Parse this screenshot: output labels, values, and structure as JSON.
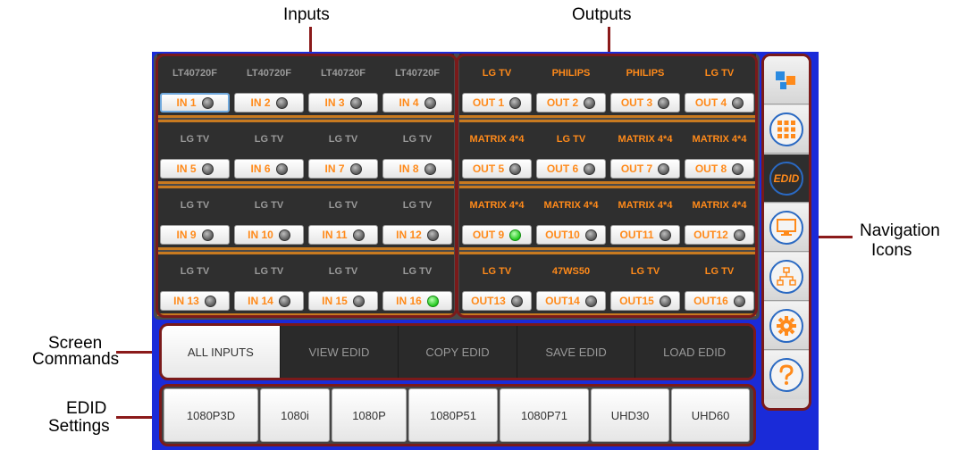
{
  "annotations": {
    "inputs": "Inputs",
    "outputs": "Outputs",
    "navigation_line1": "Navigation",
    "navigation_line2": "Icons",
    "screen_commands_line1": "Screen",
    "screen_commands_line2": "Commands",
    "edid_settings_line1": "EDID",
    "edid_settings_line2": "Settings"
  },
  "inputs": [
    {
      "label": "LT40720F",
      "button": "IN 1",
      "led": "off",
      "selected": true
    },
    {
      "label": "LT40720F",
      "button": "IN 2",
      "led": "off"
    },
    {
      "label": "LT40720F",
      "button": "IN 3",
      "led": "off"
    },
    {
      "label": "LT40720F",
      "button": "IN 4",
      "led": "off"
    },
    {
      "label": "LG TV",
      "button": "IN 5",
      "led": "off"
    },
    {
      "label": "LG TV",
      "button": "IN 6",
      "led": "off"
    },
    {
      "label": "LG TV",
      "button": "IN 7",
      "led": "off"
    },
    {
      "label": "LG TV",
      "button": "IN 8",
      "led": "off"
    },
    {
      "label": "LG TV",
      "button": "IN 9",
      "led": "off"
    },
    {
      "label": "LG TV",
      "button": "IN 10",
      "led": "off"
    },
    {
      "label": "LG TV",
      "button": "IN 11",
      "led": "off"
    },
    {
      "label": "LG TV",
      "button": "IN 12",
      "led": "off"
    },
    {
      "label": "LG TV",
      "button": "IN 13",
      "led": "off"
    },
    {
      "label": "LG TV",
      "button": "IN 14",
      "led": "off"
    },
    {
      "label": "LG TV",
      "button": "IN 15",
      "led": "off"
    },
    {
      "label": "LG TV",
      "button": "IN 16",
      "led": "on"
    }
  ],
  "outputs": [
    {
      "label": "LG TV",
      "button": "OUT 1",
      "led": "off"
    },
    {
      "label": "PHILIPS",
      "button": "OUT 2",
      "led": "off"
    },
    {
      "label": "PHILIPS",
      "button": "OUT 3",
      "led": "off"
    },
    {
      "label": "LG TV",
      "button": "OUT 4",
      "led": "off"
    },
    {
      "label": "MATRIX 4*4",
      "button": "OUT 5",
      "led": "off"
    },
    {
      "label": "LG TV",
      "button": "OUT 6",
      "led": "off"
    },
    {
      "label": "MATRIX 4*4",
      "button": "OUT 7",
      "led": "off"
    },
    {
      "label": "MATRIX 4*4",
      "button": "OUT 8",
      "led": "off"
    },
    {
      "label": "MATRIX 4*4",
      "button": "OUT 9",
      "led": "on"
    },
    {
      "label": "MATRIX 4*4",
      "button": "OUT10",
      "led": "off"
    },
    {
      "label": "MATRIX 4*4",
      "button": "OUT11",
      "led": "off"
    },
    {
      "label": "MATRIX 4*4",
      "button": "OUT12",
      "led": "off"
    },
    {
      "label": "LG TV",
      "button": "OUT13",
      "led": "off"
    },
    {
      "label": "47WS50",
      "button": "OUT14",
      "led": "off"
    },
    {
      "label": "LG TV",
      "button": "OUT15",
      "led": "off"
    },
    {
      "label": "LG TV",
      "button": "OUT16",
      "led": "off"
    }
  ],
  "commands": [
    {
      "label": "ALL INPUTS",
      "active": true
    },
    {
      "label": "VIEW EDID",
      "active": false
    },
    {
      "label": "COPY EDID",
      "active": false
    },
    {
      "label": "SAVE EDID",
      "active": false
    },
    {
      "label": "LOAD EDID",
      "active": false
    }
  ],
  "edid_settings": [
    "1080P3D",
    "1080i",
    "1080P",
    "1080P51",
    "1080P71",
    "UHD30",
    "UHD60"
  ],
  "navigation": [
    {
      "icon": "logo-icon"
    },
    {
      "icon": "grid-icon"
    },
    {
      "icon": "edid-icon",
      "text": "EDID",
      "active": true
    },
    {
      "icon": "monitor-icon"
    },
    {
      "icon": "network-icon"
    },
    {
      "icon": "gear-icon"
    },
    {
      "icon": "help-icon"
    }
  ],
  "colors": {
    "accent_orange": "#ff8a1a",
    "annotation_line": "#8b1a1a",
    "screen_background": "#1a2bd8",
    "nav_circle": "#2a69c2",
    "led_on": "#22c81e"
  }
}
